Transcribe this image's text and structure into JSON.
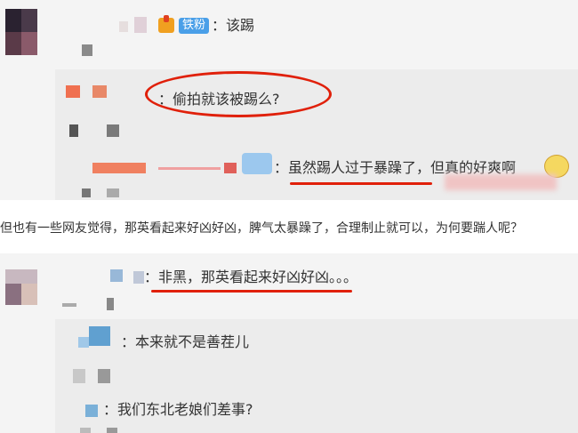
{
  "screenshot1": {
    "top_comment": {
      "badge": "铁粉",
      "text": "：该踢"
    },
    "reply1": {
      "text": "：偷拍就该被踢么?"
    },
    "reply2": {
      "text": "：虽然踢人过于暴躁了，但真的好爽啊"
    }
  },
  "caption": "但也有一些网友觉得，那英看起来好凶好凶，脾气太暴躁了，合理制止就可以，为何要踹人呢？",
  "screenshot2": {
    "top_comment": {
      "text": "：非黑，那英看起来好凶好凶。。。"
    },
    "reply1": {
      "text": "：本来就不是善茬儿"
    },
    "reply2": {
      "text": "：我们东北老娘们差事?"
    }
  },
  "colors": {
    "accent_red": "#e0200a",
    "badge_blue": "#4a9fe8"
  }
}
